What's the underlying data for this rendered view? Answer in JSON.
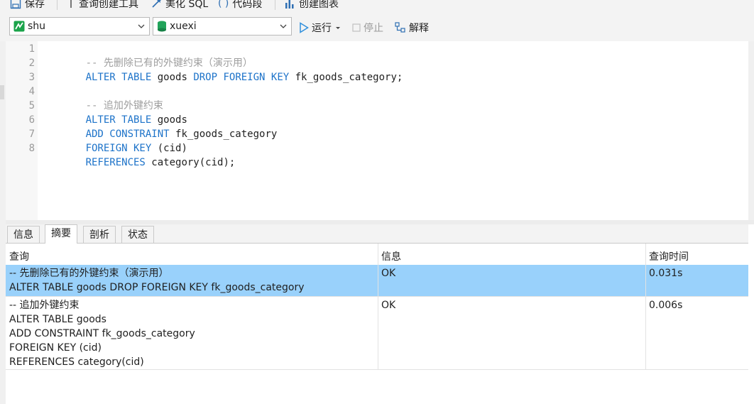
{
  "toolbar": {
    "save_label": "保存",
    "query_builder_label": "查询创建工具",
    "beautify_label": "美化 SQL",
    "snippet_label": "代码段",
    "chart_label": "创建图表"
  },
  "connection": {
    "selected": "shu",
    "database": "xuexi"
  },
  "actions": {
    "run_label": "运行",
    "stop_label": "停止",
    "explain_label": "解释"
  },
  "editor": {
    "lines": [
      {
        "n": "1",
        "parts": [
          {
            "t": "-- 先删除已有的外键约束（演示用）",
            "c": "cm"
          }
        ]
      },
      {
        "n": "2",
        "parts": [
          {
            "t": "ALTER TABLE",
            "c": "kw"
          },
          {
            "t": " goods ",
            "c": "tx"
          },
          {
            "t": "DROP FOREIGN KEY",
            "c": "kw"
          },
          {
            "t": " fk_goods_category;",
            "c": "tx"
          }
        ]
      },
      {
        "n": "3",
        "parts": []
      },
      {
        "n": "4",
        "parts": [
          {
            "t": "-- 追加外键约束",
            "c": "cm"
          }
        ]
      },
      {
        "n": "5",
        "parts": [
          {
            "t": "ALTER TABLE",
            "c": "kw"
          },
          {
            "t": " goods",
            "c": "tx"
          }
        ]
      },
      {
        "n": "6",
        "parts": [
          {
            "t": "ADD CONSTRAINT",
            "c": "kw"
          },
          {
            "t": " fk_goods_category",
            "c": "tx"
          }
        ]
      },
      {
        "n": "7",
        "parts": [
          {
            "t": "FOREIGN KEY",
            "c": "kw"
          },
          {
            "t": " (cid)",
            "c": "tx"
          }
        ]
      },
      {
        "n": "8",
        "parts": [
          {
            "t": "REFERENCES",
            "c": "kw"
          },
          {
            "t": " category(cid);",
            "c": "tx"
          }
        ]
      }
    ]
  },
  "result_tabs": {
    "info": "信息",
    "summary": "摘要",
    "profile": "剖析",
    "status": "状态",
    "active": "摘要"
  },
  "summary_table": {
    "columns": [
      "查询",
      "信息",
      "查询时间"
    ],
    "rows": [
      {
        "query_lines": [
          "-- 先删除已有的外键约束（演示用）",
          "ALTER TABLE goods DROP FOREIGN KEY fk_goods_category"
        ],
        "info": "OK",
        "time": "0.031s",
        "selected": true
      },
      {
        "query_lines": [
          "-- 追加外键约束",
          "ALTER TABLE goods",
          "ADD CONSTRAINT fk_goods_category",
          "FOREIGN KEY (cid)",
          "REFERENCES category(cid)"
        ],
        "info": "OK",
        "time": "0.006s",
        "selected": false
      }
    ]
  },
  "colors": {
    "keyword": "#1d73c9",
    "comment": "#9e9e9e",
    "selected_row": "#99d1fb",
    "connection_icon": "#1aa34a",
    "database_icon": "#21a35a",
    "run_icon": "#2f8fdc"
  },
  "icons": {
    "save": "save-icon",
    "query_builder": "query-builder-icon",
    "beautify": "magic-wand-icon",
    "snippet": "braces-icon",
    "chart": "chart-icon",
    "connection": "connection-icon",
    "database": "database-icon",
    "run": "play-icon",
    "stop": "stop-icon",
    "explain": "explain-icon"
  }
}
